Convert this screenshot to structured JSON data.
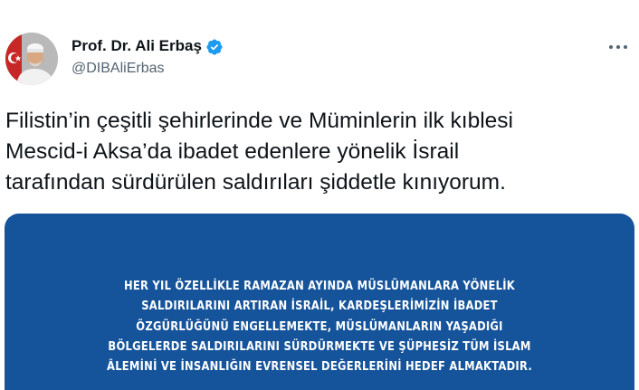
{
  "tweet": {
    "author": {
      "name": "Prof. Dr. Ali Erbaş",
      "handle": "@DIBAliErbas",
      "verified_icon": "verified-badge-icon",
      "avatar_icon": "profile-avatar-image"
    },
    "more_icon": "more-options-icon",
    "text": "Filistin’in çeşitli şehirlerinde ve Müminlerin ilk kıblesi\nMescid-i Aksa’da ibadet edenlere yönelik İsrail\ntarafından sürdürülen saldırıları şiddetle kınıyorum.",
    "media": {
      "text": "HER YIL ÖZELLİKLE RAMAZAN AYINDA MÜSLÜMANLARA YÖNELİK\nSALDIRILARINI ARTIRAN İSRAİL, KARDEŞLERİMİZİN İBADET\nÖZGÜRLÜĞÜNÜ ENGELLEMEKTE, MÜSLÜMANLARIN YAŞADIĞI\nBÖLGELERDE SALDIRILARINI SÜRDÜRMEKTE VE ŞÜPHESİZ TÜM İSLAM\nÂLEMİNİ VE İNSANLIĞIN EVRENSEL DEĞERLERİNİ HEDEF ALMAKTADIR.",
      "background_color": "#15539a"
    }
  },
  "colors": {
    "accent": "#1d9bf0",
    "text_primary": "#0f1419",
    "text_secondary": "#536471"
  }
}
